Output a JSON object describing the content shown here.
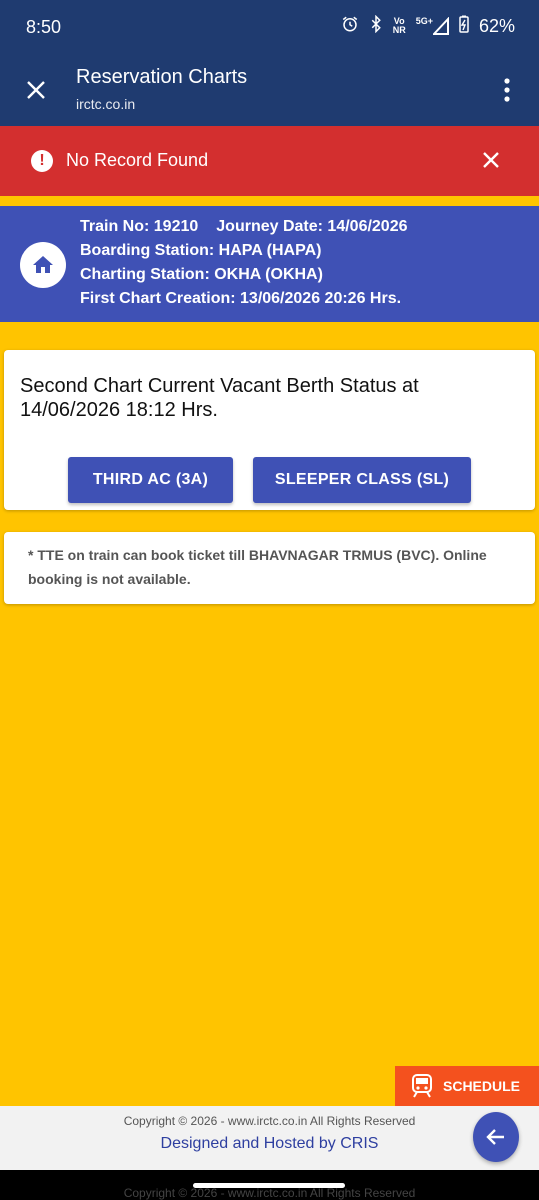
{
  "status_bar": {
    "time": "8:50",
    "network_top": "Vo",
    "network_bottom": "NR",
    "signal": "5G+",
    "battery": "62%"
  },
  "app_bar": {
    "title": "Reservation Charts",
    "url": "irctc.co.in"
  },
  "error": {
    "message": "No Record Found"
  },
  "train_info": {
    "train_no": "Train No: 19210",
    "journey_date": "Journey Date: 14/06/2026",
    "boarding": "Boarding Station: HAPA (HAPA)",
    "charting": "Charting Station: OKHA (OKHA)",
    "first_chart": "First Chart Creation: 13/06/2026 20:26 Hrs."
  },
  "status_card": {
    "title": "Second Chart Current Vacant Berth Status at 14/06/2026 18:12 Hrs.",
    "buttons": [
      "THIRD AC (3A)",
      "SLEEPER CLASS (SL)"
    ]
  },
  "note": {
    "text": "* TTE on train can book ticket till BHAVNAGAR TRMUS (BVC). Online booking is not available."
  },
  "schedule": {
    "label": "SCHEDULE"
  },
  "footer": {
    "copyright": "Copyright © 2026 - www.irctc.co.in All Rights Reserved",
    "hosted_prefix": "Designed and Hosted by ",
    "hosted_link": "CRIS"
  },
  "colors": {
    "app_bar": "#1F3B70",
    "error": "#D32F2F",
    "primary": "#3F51B5",
    "page_bg": "#FFC400",
    "schedule": "#F4511E"
  },
  "icons": [
    "alarm-icon",
    "bluetooth-icon",
    "signal-icon",
    "battery-icon",
    "close-icon",
    "more-vert-icon",
    "error-icon",
    "home-icon",
    "train-icon",
    "arrow-back-icon"
  ]
}
